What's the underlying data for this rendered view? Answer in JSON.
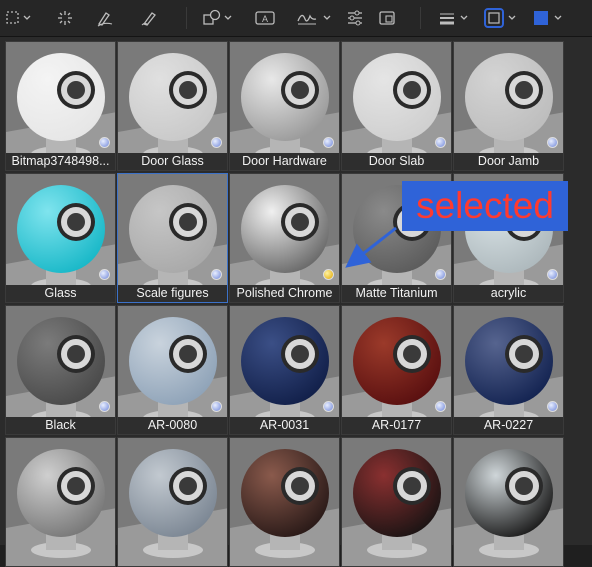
{
  "toolbar": {
    "icons": [
      "select-tool-icon",
      "magic-wand-icon",
      "sketch-icon",
      "draw-icon",
      "shapes-icon",
      "text-box-icon",
      "sign-icon",
      "adjust-icon",
      "page-layout-icon",
      "line-style-icon",
      "border-color-icon",
      "fill-color-icon"
    ],
    "border_color": "#2f63d8",
    "fill_color": "#2f63d8"
  },
  "materials": [
    {
      "label": "Bitmap3748498..."
    },
    {
      "label": "Door Glass"
    },
    {
      "label": "Door Hardware"
    },
    {
      "label": "Door Slab"
    },
    {
      "label": "Door Jamb"
    },
    {
      "label": "Glass"
    },
    {
      "label": "Scale figures"
    },
    {
      "label": "Polished Chrome"
    },
    {
      "label": "Matte Titanium"
    },
    {
      "label": "acrylic"
    },
    {
      "label": "Black"
    },
    {
      "label": "AR-0080"
    },
    {
      "label": "AR-0031"
    },
    {
      "label": "AR-0177"
    },
    {
      "label": "AR-0227"
    },
    {
      "label": ""
    },
    {
      "label": ""
    },
    {
      "label": ""
    },
    {
      "label": ""
    },
    {
      "label": ""
    }
  ],
  "selected_index": 6,
  "highlighted_index": 7,
  "annotation": {
    "text": "selected",
    "box_color": "#2f63d8",
    "text_color": "#ff3a2f"
  }
}
